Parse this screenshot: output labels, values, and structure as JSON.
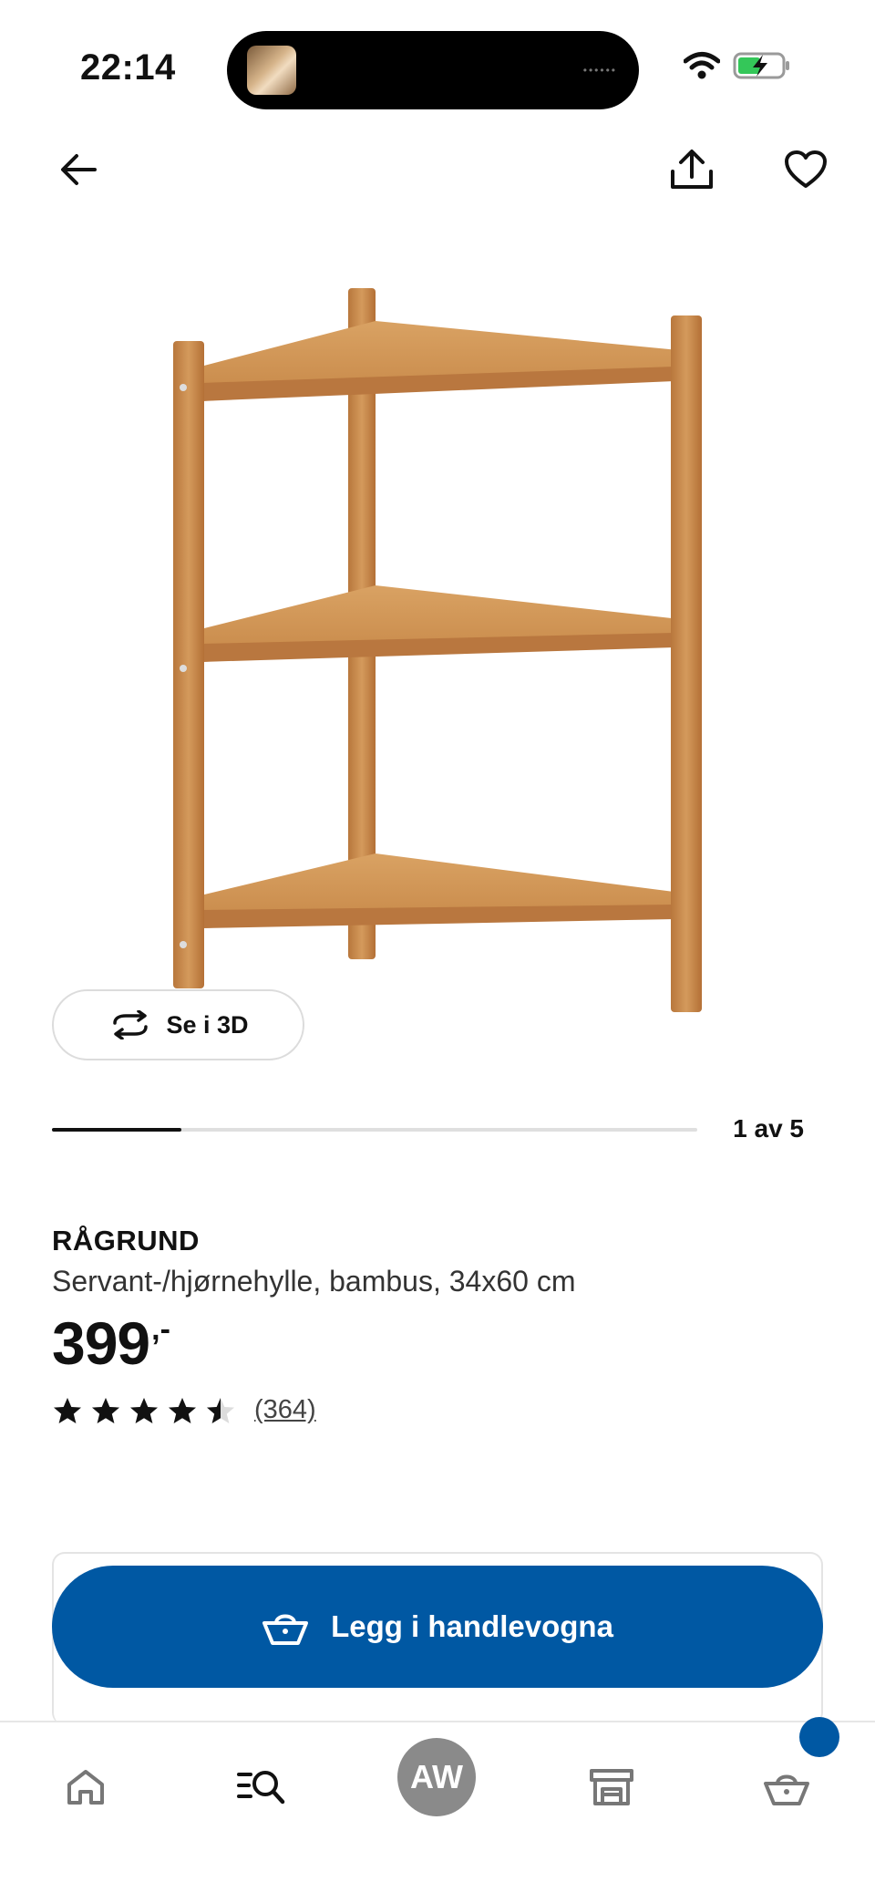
{
  "status_bar": {
    "time": "22:14",
    "icons": [
      "wifi-icon",
      "battery-charging-icon"
    ]
  },
  "top_nav": {
    "icons": [
      "arrow-left-icon",
      "share-icon",
      "heart-icon"
    ]
  },
  "product": {
    "view_3d_label": "Se i 3D",
    "image_index_label": "1 av 5",
    "image_progress": 0.2,
    "name": "RÅGRUND",
    "description": "Servant-/hjørnehylle, bambus, 34x60 cm",
    "price": "399",
    "price_suffix": ",-",
    "rating_value": 4.5,
    "review_count": "(364)"
  },
  "actions": {
    "add_to_cart_label": "Legg i handlevogna"
  },
  "bottom_nav": {
    "items": [
      "home-icon",
      "search-list-icon",
      "profile-avatar",
      "store-icon",
      "cart-icon"
    ],
    "avatar_initials": "AW"
  },
  "colors": {
    "accent": "#0058a3",
    "text": "#111111",
    "avatar_bg": "#8a8a8a",
    "wood": "#c8874a"
  }
}
